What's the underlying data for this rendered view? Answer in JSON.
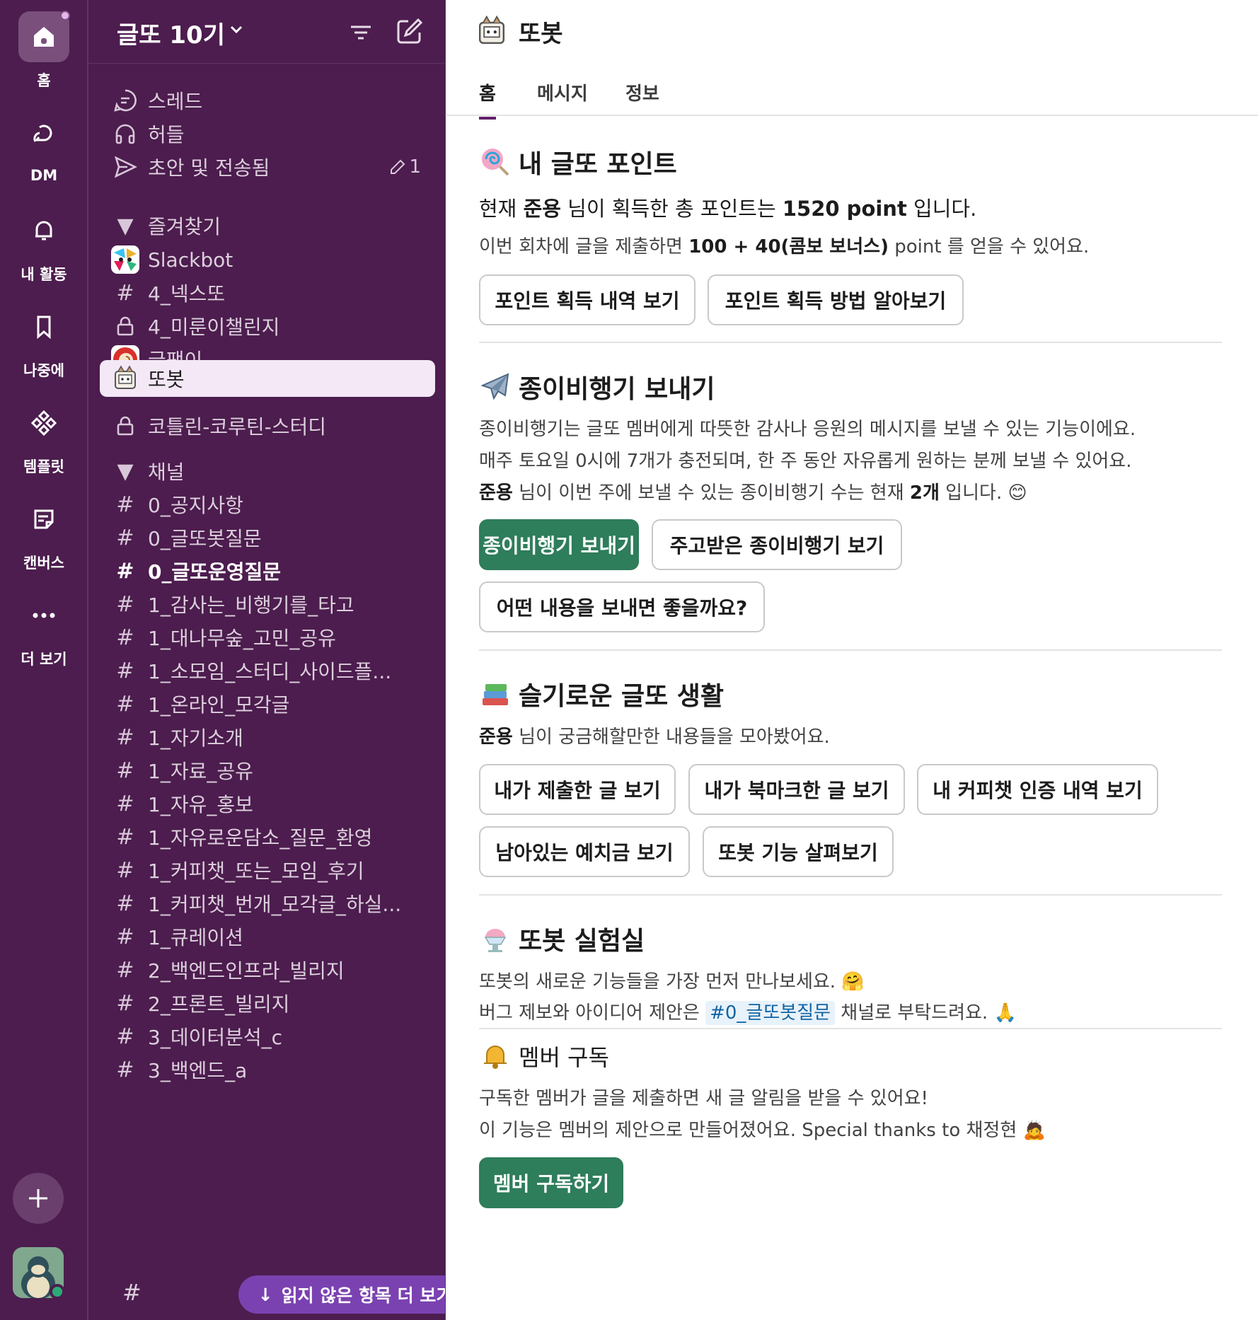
{
  "rail": {
    "items": [
      {
        "label": "홈",
        "icon": "home-icon"
      },
      {
        "label": "DM",
        "icon": "dm-icon"
      },
      {
        "label": "내 활동",
        "icon": "bell-icon"
      },
      {
        "label": "나중에",
        "icon": "bookmark-icon"
      },
      {
        "label": "템플릿",
        "icon": "template-icon"
      },
      {
        "label": "캔버스",
        "icon": "canvas-icon"
      },
      {
        "label": "더 보기",
        "icon": "more-icon"
      }
    ]
  },
  "workspace": {
    "name": "글또 10기"
  },
  "sidebar": {
    "top_items": [
      {
        "label": "스레드",
        "icon": "threads-icon"
      },
      {
        "label": "허들",
        "icon": "headphones-icon"
      },
      {
        "label": "초안 및 전송됨",
        "icon": "send-icon",
        "count": "1"
      }
    ],
    "favorites_label": "즐겨찾기",
    "favorites": [
      {
        "label": "Slackbot",
        "type": "app"
      },
      {
        "label": "4_넥스또",
        "type": "channel"
      },
      {
        "label": "4_미룬이챌린지",
        "type": "private"
      },
      {
        "label": "글팽이",
        "type": "app"
      },
      {
        "label": "또봇",
        "type": "app"
      },
      {
        "label": "코틀린-코루틴-스터디",
        "type": "private"
      }
    ],
    "channels_label": "채널",
    "channels": [
      {
        "label": "0_공지사항",
        "bold": false
      },
      {
        "label": "0_글또봇질문",
        "bold": false
      },
      {
        "label": "0_글또운영질문",
        "bold": true
      },
      {
        "label": "1_감사는_비행기를_타고",
        "bold": false
      },
      {
        "label": "1_대나무숲_고민_공유",
        "bold": false
      },
      {
        "label": "1_소모임_스터디_사이드플...",
        "bold": false
      },
      {
        "label": "1_온라인_모각글",
        "bold": false
      },
      {
        "label": "1_자기소개",
        "bold": false
      },
      {
        "label": "1_자료_공유",
        "bold": false
      },
      {
        "label": "1_자유_홍보",
        "bold": false
      },
      {
        "label": "1_자유로운담소_질문_환영",
        "bold": false
      },
      {
        "label": "1_커피챗_또는_모임_후기",
        "bold": false
      },
      {
        "label": "1_커피챗_번개_모각글_하실...",
        "bold": false
      },
      {
        "label": "1_큐레이션",
        "bold": false
      },
      {
        "label": "2_백엔드인프라_빌리지",
        "bold": false
      },
      {
        "label": "2_프론트_빌리지",
        "bold": false
      },
      {
        "label": "3_데이터분석_c",
        "bold": false
      },
      {
        "label": "3_백엔드_a",
        "bold": false
      }
    ],
    "more_unread": "읽지 않은 항목 더 보기"
  },
  "main": {
    "bot_name": "또봇",
    "tabs": [
      "홈",
      "메시지",
      "정보"
    ],
    "points": {
      "title": "내 글또 포인트",
      "l1a": "현재 ",
      "l1_name": "준용",
      "l1b": " 님이 획득한 총 포인트는 ",
      "l1_points": "1520 point",
      "l1c": " 입니다.",
      "l2a": "이번 회차에 글을 제출하면 ",
      "l2_bonus": "100 + 40(콤보 보너스)",
      "l2b": " point 를 얻을 수 있어요.",
      "btn_history": "포인트 획득 내역 보기",
      "btn_how": "포인트 획득 방법 알아보기"
    },
    "plane": {
      "title": "종이비행기 보내기",
      "l1": "종이비행기는 글또 멤버에게 따뜻한 감사나 응원의 메시지를 보낼 수 있는 기능이에요.",
      "l2": "매주 토요일 0시에 7개가 충전되며, 한 주 동안 자유롭게 원하는 분께 보낼 수 있어요.",
      "l3_name": "준용",
      "l3a": " 님이 이번 주에 보낼 수 있는 종이비행기 수는 현재 ",
      "l3_count": "2개",
      "l3b": " 입니다.",
      "btn_send": "종이비행기 보내기",
      "btn_received": "주고받은 종이비행기 보기",
      "btn_what": "어떤 내용을 보내면 좋을까요?"
    },
    "life": {
      "title": "슬기로운 글또 생활",
      "l1_name": "준용",
      "l1": " 님이 궁금해할만한 내용들을 모아봤어요.",
      "btn_submitted": "내가 제출한 글 보기",
      "btn_bookmarked": "내가 북마크한 글 보기",
      "btn_coffee": "내 커피챗 인증 내역 보기",
      "btn_deposit": "남아있는 예치금 보기",
      "btn_features": "또봇 기능 살펴보기"
    },
    "lab": {
      "title": "또봇 실험실",
      "l1": "또봇의 새로운 기능들을 가장 먼저 만나보세요.",
      "l2a": "버그 제보와 아이디어 제안은 ",
      "l2_channel": "#0_글또봇질문",
      "l2b": " 채널로 부탁드려요."
    },
    "subscribe": {
      "title": "멤버 구독",
      "l1": "구독한 멤버가 글을 제출하면 새 글 알림을 받을 수 있어요!",
      "l2": "이 기능은 멤버의 제안으로 만들어졌어요. Special thanks to 채정현",
      "btn": "멤버 구독하기"
    }
  },
  "colors": {
    "aubergine": "#4c1d4e",
    "active_row": "#f4e8f6",
    "primary_green": "#2e7d5b",
    "unread_pill": "#7a42b0",
    "link_blue": "#1264a3"
  }
}
